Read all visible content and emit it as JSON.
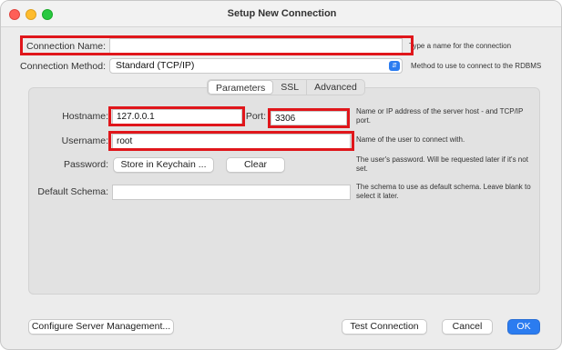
{
  "window": {
    "title": "Setup New Connection"
  },
  "connection_name": {
    "label": "Connection Name:",
    "value": "",
    "help": "Type a name for the connection"
  },
  "connection_method": {
    "label": "Connection Method:",
    "value": "Standard (TCP/IP)",
    "help": "Method to use to connect to the RDBMS"
  },
  "tabs": [
    {
      "label": "Parameters",
      "active": true
    },
    {
      "label": "SSL",
      "active": false
    },
    {
      "label": "Advanced",
      "active": false
    }
  ],
  "parameters": {
    "hostname": {
      "label": "Hostname:",
      "value": "127.0.0.1"
    },
    "port": {
      "label": "Port:",
      "value": "3306"
    },
    "host_help": "Name or IP address of the server host - and TCP/IP port.",
    "username": {
      "label": "Username:",
      "value": "root",
      "help": "Name of the user to connect with."
    },
    "password": {
      "label": "Password:",
      "store_button": "Store in Keychain ...",
      "clear_button": "Clear",
      "help": "The user's password. Will be requested later if it's not set."
    },
    "default_schema": {
      "label": "Default Schema:",
      "value": "",
      "help": "The schema to use as default schema. Leave blank to select it later."
    }
  },
  "buttons": {
    "configure": "Configure Server Management...",
    "test": "Test Connection",
    "cancel": "Cancel",
    "ok": "OK"
  },
  "colors": {
    "accent": "#2b7cf0",
    "highlight": "#e0161b"
  }
}
